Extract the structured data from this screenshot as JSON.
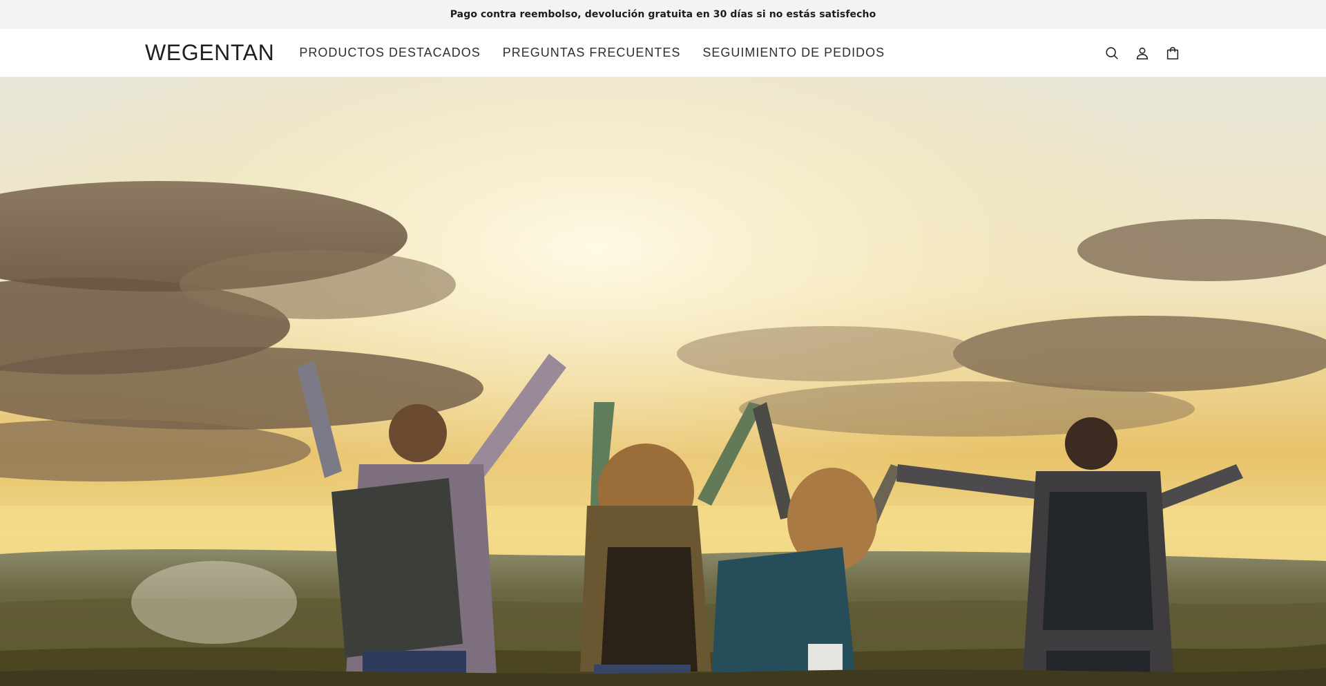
{
  "announcement": {
    "text": "Pago contra reembolso, devolución gratuita en 30 días si no estás satisfecho"
  },
  "header": {
    "logo": "WEGENTAN",
    "nav": [
      {
        "label": "PRODUCTOS DESTACADOS"
      },
      {
        "label": "PREGUNTAS FRECUENTES"
      },
      {
        "label": "SEGUIMIENTO DE PEDIDOS"
      }
    ],
    "icons": [
      "search-icon",
      "account-icon",
      "cart-icon"
    ]
  },
  "hero": {
    "image": "group-of-hikers-with-backpacks-raising-hands-at-sunset",
    "colors": {
      "sky_light": "#f4eccd",
      "sky_warm": "#e7c57a",
      "cloud_dark": "#6e5a45",
      "field": "#6f6a3a"
    }
  }
}
